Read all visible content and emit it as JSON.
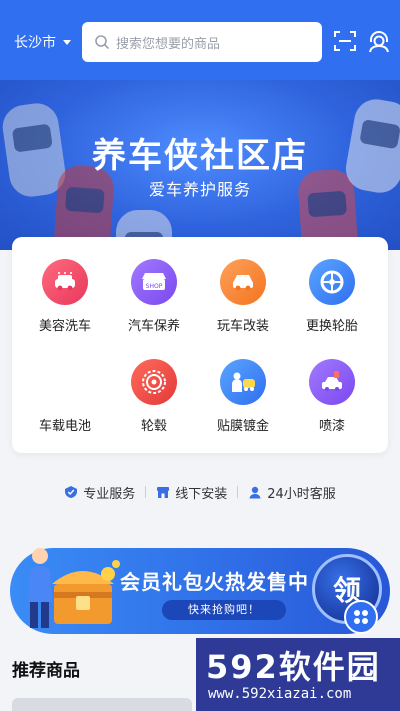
{
  "header": {
    "city": "长沙市",
    "search_placeholder": "搜索您想要的商品"
  },
  "banner": {
    "title": "养车侠社区店",
    "subtitle": "爱车养护服务"
  },
  "services": [
    {
      "label": "美容洗车",
      "icon": "car-wash-icon",
      "color": "#ef4a6a"
    },
    {
      "label": "汽车保养",
      "icon": "shop-icon",
      "color": "#8a5cf6"
    },
    {
      "label": "玩车改装",
      "icon": "car-modify-icon",
      "color": "#f5822a"
    },
    {
      "label": "更换轮胎",
      "icon": "tire-icon",
      "color": "#3a86f5"
    },
    {
      "label": "车载电池",
      "icon": "battery-icon",
      "color": "#ffffff"
    },
    {
      "label": "轮毂",
      "icon": "wheel-hub-icon",
      "color": "#ee4343"
    },
    {
      "label": "贴膜镀金",
      "icon": "film-icon",
      "color": "#3a86f5"
    },
    {
      "label": "喷漆",
      "icon": "spray-paint-icon",
      "color": "#8a5cf6"
    }
  ],
  "features": [
    {
      "label": "专业服务",
      "icon": "shield-check-icon"
    },
    {
      "label": "线下安装",
      "icon": "store-icon"
    },
    {
      "label": "24小时客服",
      "icon": "customer-service-icon"
    }
  ],
  "promo": {
    "title": "会员礼包火热发售中",
    "cta": "快来抢购吧！",
    "badge": "领"
  },
  "recommended": {
    "title": "推荐商品"
  },
  "watermark": {
    "brand": "592软件园",
    "url": "www.592xiazai.com"
  },
  "colors": {
    "primary": "#2f6ff0",
    "background": "#f2f4f8"
  }
}
